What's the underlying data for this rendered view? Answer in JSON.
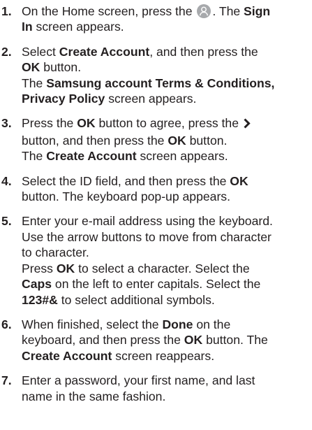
{
  "steps": [
    {
      "num": "1.",
      "lines": [
        [
          "On the Home screen, press the ",
          {
            "icon": "person-icon"
          },
          ". The ",
          {
            "b": "Sign"
          }
        ],
        [
          {
            "b": "In"
          },
          " screen appears."
        ]
      ]
    },
    {
      "num": "2.",
      "lines": [
        [
          "Select ",
          {
            "b": "Create Account"
          },
          ", and then press the"
        ],
        [
          {
            "b": "OK"
          },
          " button."
        ],
        [
          "The ",
          {
            "b": "Samsung account Terms & Conditions,"
          }
        ],
        [
          {
            "b": "Privacy Policy"
          },
          " screen appears."
        ]
      ]
    },
    {
      "num": "3.",
      "lines": [
        [
          "Press the ",
          {
            "b": "OK"
          },
          " button to agree, press the ",
          {
            "icon": "chevron-right-icon"
          }
        ],
        [
          "button, and then press the ",
          {
            "b": "OK"
          },
          " button."
        ],
        [
          "The ",
          {
            "b": "Create Account"
          },
          " screen appears."
        ]
      ]
    },
    {
      "num": "4.",
      "lines": [
        [
          "Select the ID field, and then press the ",
          {
            "b": "OK"
          }
        ],
        [
          "button. The keyboard pop-up appears."
        ]
      ]
    },
    {
      "num": "5.",
      "lines": [
        [
          "Enter your e-mail address using the keyboard."
        ],
        [
          "Use the arrow buttons to move from character"
        ],
        [
          "to character."
        ],
        [
          "Press ",
          {
            "b": "OK"
          },
          " to select a character. Select the"
        ],
        [
          {
            "b": "Caps"
          },
          " on the left to enter capitals. Select the"
        ],
        [
          {
            "b": "123#&"
          },
          " to select additional symbols."
        ]
      ]
    },
    {
      "num": "6.",
      "lines": [
        [
          "When finished, select the ",
          {
            "b": "Done"
          },
          " on the"
        ],
        [
          "keyboard, and then press the ",
          {
            "b": "OK"
          },
          " button. The"
        ],
        [
          {
            "b": "Create Account"
          },
          " screen reappears."
        ]
      ]
    },
    {
      "num": "7.",
      "lines": [
        [
          "Enter a password, your first name, and last"
        ],
        [
          "name in the same fashion."
        ]
      ]
    }
  ]
}
